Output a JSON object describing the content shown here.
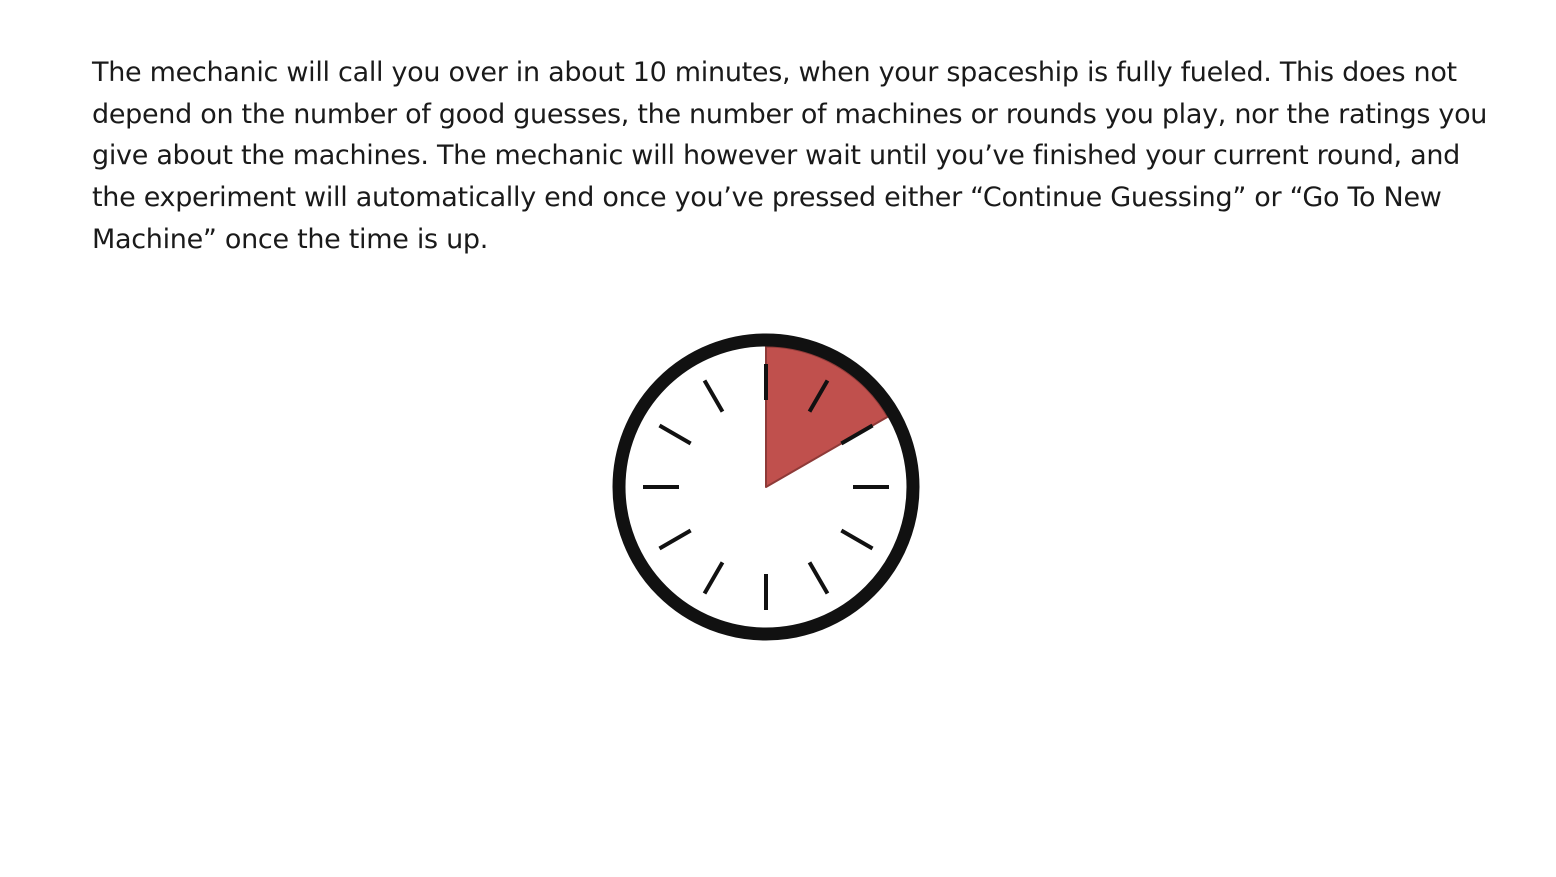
{
  "instructions": {
    "text": "The mechanic will call you over in about 10 minutes, when your spaceship is fully fueled. This does not depend on the number of good guesses, the number of machines or rounds you play, nor the ratings you give about the machines. The mechanic will however wait until you’ve finished your current round, and the experiment will automatically end once you’ve pressed either “Continue Guessing” or “Go To New Machine” once the time is up."
  },
  "timer": {
    "icon": "clock-timer-icon",
    "elapsed_fraction": 0.1667,
    "elapsed_color": "#c0504d",
    "rim_color": "#111111",
    "tick_color": "#111111",
    "tick_count": 12
  }
}
